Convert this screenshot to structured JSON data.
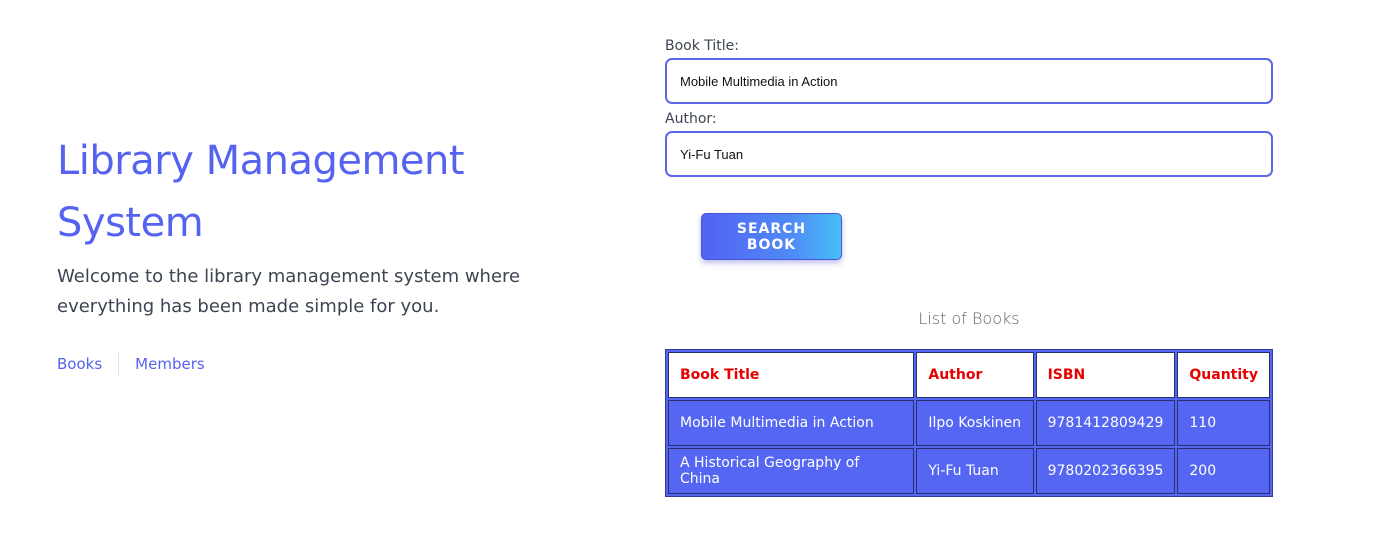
{
  "hero": {
    "title": "Library Management System",
    "description": "Welcome to the library management system where everything has been made simple for you.",
    "links": [
      "Books",
      "Members"
    ]
  },
  "form": {
    "book_title_label": "Book Title:",
    "book_title_value": "Mobile Multimedia in Action",
    "author_label": "Author:",
    "author_value": "Yi-Fu Tuan",
    "search_button": "SEARCH BOOK"
  },
  "list": {
    "caption": "List of Books",
    "headers": [
      "Book Title",
      "Author",
      "ISBN",
      "Quantity"
    ],
    "rows": [
      [
        "Mobile Multimedia in Action",
        "Ilpo Koskinen",
        "9781412809429",
        "110"
      ],
      [
        "A Historical Geography of China",
        "Yi-Fu Tuan",
        "9780202366395",
        "200"
      ]
    ]
  },
  "colors": {
    "accent": "#5663f0",
    "header_text": "#e60000",
    "row_bg": "#5566f2"
  }
}
